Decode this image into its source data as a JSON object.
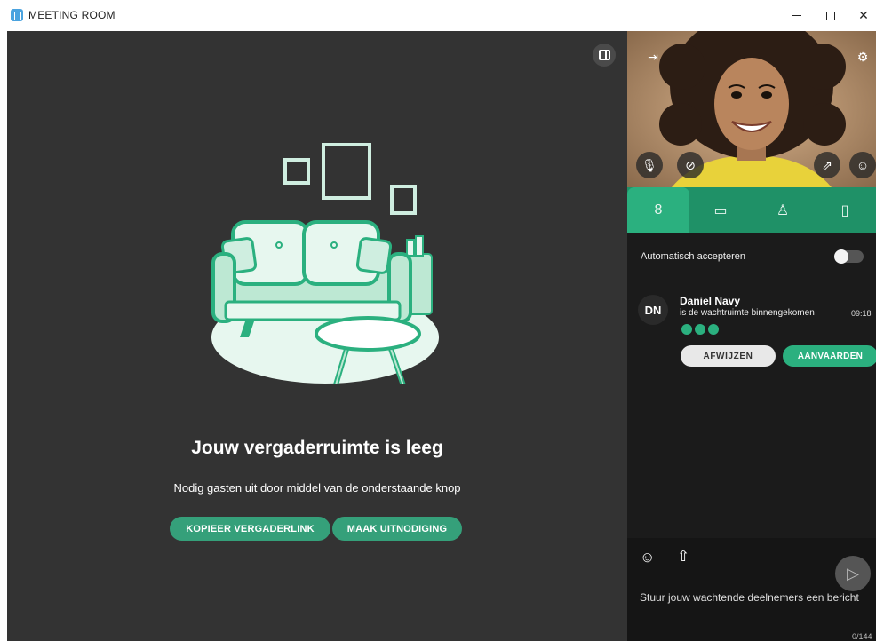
{
  "window": {
    "title": "MEETING ROOM",
    "controls": {
      "minimize": "minimize-icon",
      "maximize": "maximize-icon",
      "close": "✕"
    }
  },
  "stage": {
    "layout_toggle_icon": "sidebar-layout-icon",
    "empty_title": "Jouw vergaderruimte is leeg",
    "empty_subtitle": "Nodig gasten uit door middel van de onderstaande knop",
    "buttons": {
      "copy_link": "KOPIEER VERGADERLINK",
      "invite": "MAAK UITNODIGING"
    }
  },
  "video_controls": {
    "leave": "leave-icon",
    "settings": "gear-icon",
    "mic": "microphone-icon",
    "camera": "camera-off-icon",
    "share": "screen-share-icon",
    "reactions": "emoji-icon"
  },
  "tabs": [
    {
      "name": "waiting-room",
      "icon": "8",
      "active": true
    },
    {
      "name": "chat",
      "icon": "chat-icon",
      "active": false
    },
    {
      "name": "participants",
      "icon": "person-icon",
      "active": false
    },
    {
      "name": "notes",
      "icon": "document-icon",
      "active": false
    }
  ],
  "waiting_room": {
    "auto_accept_label": "Automatisch accepteren",
    "auto_accept_on": false,
    "guest": {
      "initials": "DN",
      "name": "Daniel Navy",
      "message": "is de wachtruimte binnengekomen",
      "time": "09:18",
      "status_icons": [
        "person-icon",
        "microphone-icon",
        "camera-icon"
      ]
    },
    "reject_label": "AFWIJZEN",
    "accept_label": "AANVAARDEN"
  },
  "composer": {
    "placeholder": "Stuur jouw wachtende deelnemers een bericht",
    "counter": "0/144"
  },
  "colors": {
    "accent": "#2bb07f",
    "accent_dark": "#1f9167",
    "stage_bg": "#333333",
    "panel_bg": "#1b1b1b"
  }
}
